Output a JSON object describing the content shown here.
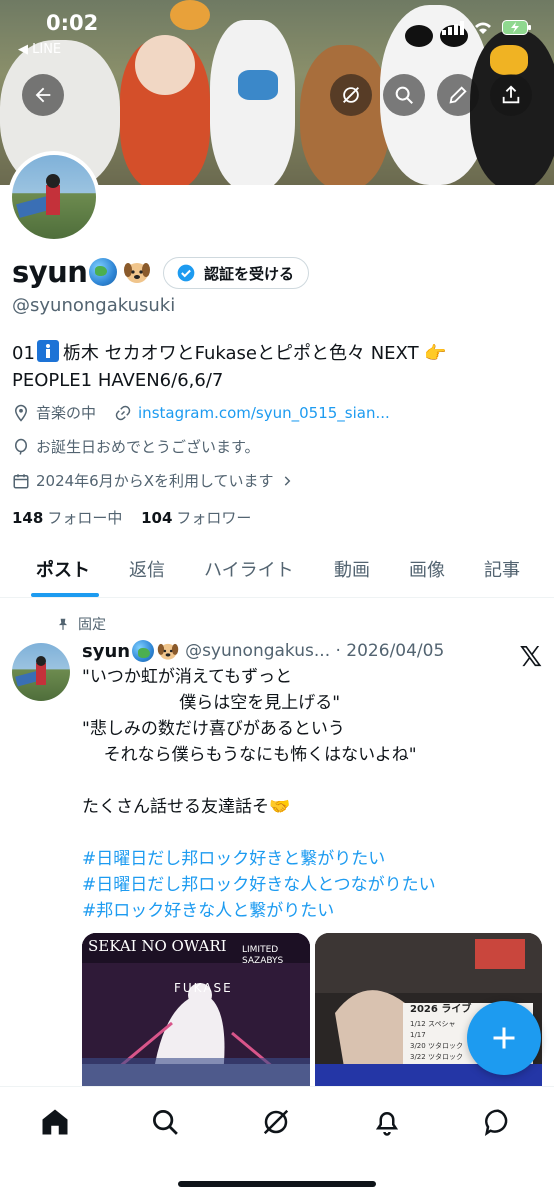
{
  "status_bar": {
    "time": "0:02",
    "back_app": "◀ LINE"
  },
  "profile": {
    "name": "syun",
    "handle": "@syunongakusuki",
    "verify_button": "認証を受ける",
    "bio_line1_prefix": "01",
    "bio_line1_rest": "栃木 セカオワとFukaseとピポと色々 NEXT 👉",
    "bio_line2": "PEOPLE1 HAVEN6/6,6/7",
    "location": "音楽の中",
    "link": "instagram.com/syun_0515_sian...",
    "birthday": "お誕生日おめでとうございます。",
    "joined": "2024年6月からXを利用しています",
    "following_count": "148",
    "following_label": "フォロー中",
    "followers_count": "104",
    "followers_label": "フォロワー"
  },
  "tabs": [
    "ポスト",
    "返信",
    "ハイライト",
    "動画",
    "画像",
    "記事"
  ],
  "post": {
    "pinned_label": "固定",
    "author": "syun",
    "meta": "@syunongakus... · 2026/04/05",
    "x_logo": "𝕏",
    "lines": [
      "\"いつか虹が消えてもずっと",
      "                  僕らは空を見上げる\"",
      "\"悲しみの数だけ喜びがあるという",
      "    それなら僕らもうなにも怖くはないよね\"",
      "",
      "たくさん話せる友達話そ🤝"
    ],
    "hashtags": [
      "#日曜日だし邦ロック好きと繋がりたい",
      "#日曜日だし邦ロック好きな人とつながりたい",
      "#邦ロック好きな人と繋がりたい"
    ],
    "media1_text_top": "SEKAI NO OWARI",
    "media1_text_right": "LIMITED SAZABYS",
    "media1_text_mid": "FUKASE",
    "media2_text": "2026 ライブ",
    "media2_lines": [
      "1/12 スペシャ",
      "1/17",
      "3/20 ツタロック",
      "3/22 ツタロック"
    ]
  },
  "colors": {
    "accent": "#1d9bf0",
    "text": "#0f1419",
    "muted": "#536471"
  }
}
